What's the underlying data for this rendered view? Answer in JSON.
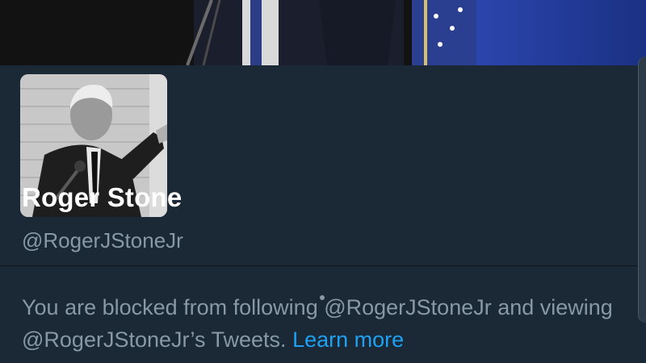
{
  "profile": {
    "display_name": "Roger Stone",
    "handle": "@RogerJStoneJr",
    "blocked_message": "You are blocked from following @RogerJStoneJr and viewing @RogerJStoneJr’s Tweets.",
    "learn_more_label": "Learn more"
  },
  "colors": {
    "background": "#1b2836",
    "secondary_text": "#8899a6",
    "link": "#1da1f2",
    "primary_text": "#ffffff"
  }
}
